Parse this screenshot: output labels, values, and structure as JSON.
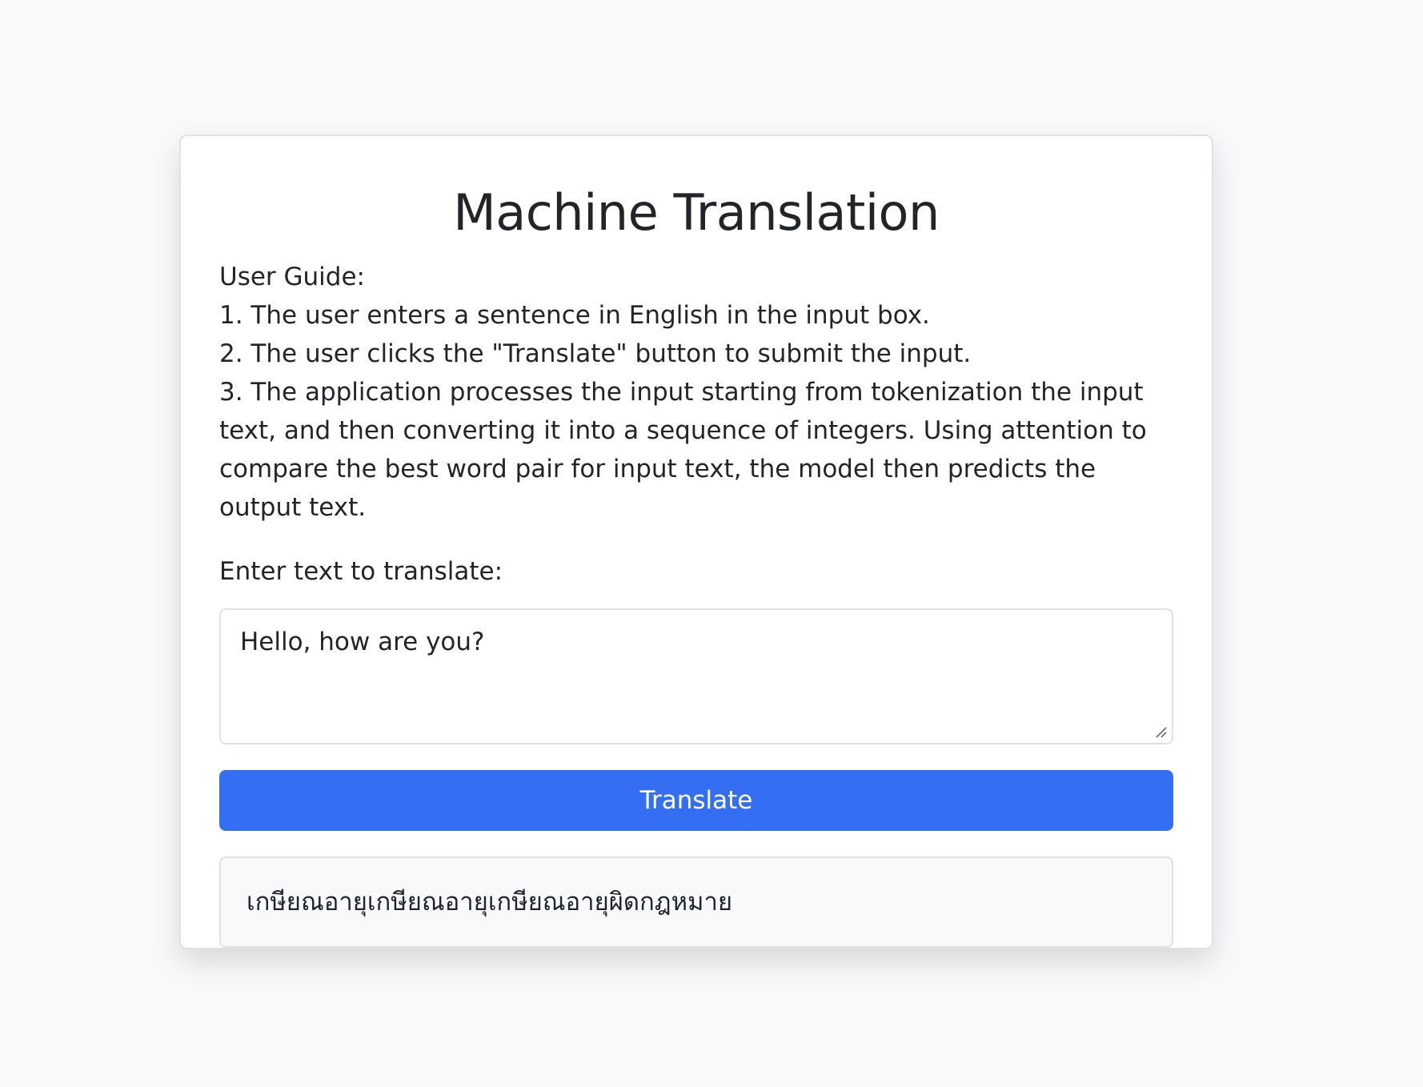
{
  "app": {
    "title": "Machine Translation"
  },
  "guide": {
    "heading": "User Guide:",
    "steps": [
      "1. The user enters a sentence in English in the input box.",
      "2. The user clicks the \"Translate\" button to submit the input.",
      "3. The application processes the input starting from tokenization the input text, and then converting it into a sequence of integers. Using attention to compare the best word pair for input text, the model then predicts the output text."
    ]
  },
  "form": {
    "label": "Enter text to translate:",
    "input_value": "Hello, how are you?",
    "button_label": "Translate"
  },
  "output": {
    "text": "เกษียณอายุเกษียณอายุเกษียณอายุผิดกฎหมาย"
  },
  "colors": {
    "accent": "#346ef3",
    "background": "#f8f9fa",
    "border": "#dee2e6"
  },
  "icons": {
    "resize": "resize-handle-icon"
  }
}
